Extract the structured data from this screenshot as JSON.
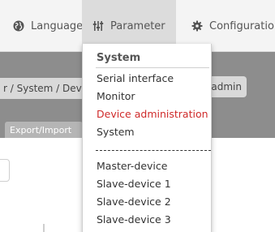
{
  "nav": {
    "language_label": "Language",
    "parameter_label": "Parameter",
    "configuration_label": "Configuration"
  },
  "background": {
    "breadcrumb": "r / System / Devi",
    "user": "admin",
    "export_tab": "Export/Import"
  },
  "dropdown": {
    "header": "System",
    "items_top": [
      {
        "label": "Serial interface",
        "active": false
      },
      {
        "label": "Monitor",
        "active": false
      },
      {
        "label": "Device administration",
        "active": true
      },
      {
        "label": "System",
        "active": false
      }
    ],
    "items_bottom": [
      {
        "label": "Master-device"
      },
      {
        "label": "Slave-device 1"
      },
      {
        "label": "Slave-device 2"
      },
      {
        "label": "Slave-device 3"
      }
    ]
  },
  "colors": {
    "active_item": "#cf2a2a",
    "nav_bg": "#f4f4f4",
    "nav_active_bg": "#dcdcdc",
    "band_bg": "#8d8d8d"
  },
  "icons": {
    "language": "globe-icon",
    "parameter": "sliders-icon",
    "configuration": "gear-icon"
  }
}
